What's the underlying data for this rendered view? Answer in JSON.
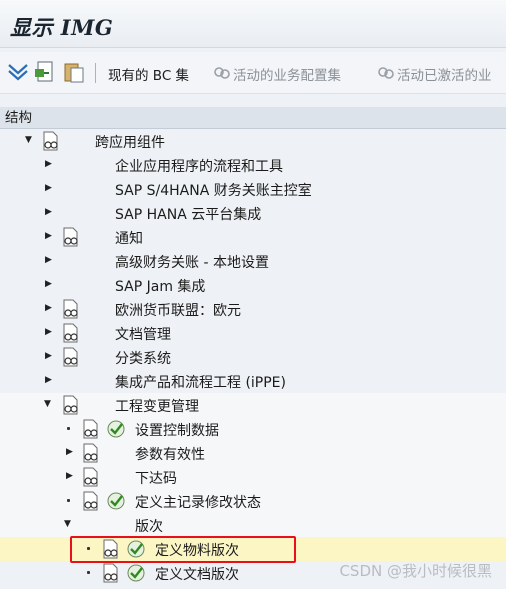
{
  "window": {
    "title": "显示 IMG"
  },
  "toolbar": {
    "bc_sets_label": "现有的 BC 集",
    "active_bc_label": "活动的业务配置集",
    "activated_label": "活动已激活的业"
  },
  "structure_header": "结构",
  "tree": {
    "root": "跨应用组件",
    "items": [
      "企业应用程序的流程和工具",
      "SAP S/4HANA 财务关账主控室",
      "SAP HANA 云平台集成",
      "通知",
      "高级财务关账 - 本地设置",
      "SAP Jam 集成",
      "欧洲货币联盟：欧元",
      "文档管理",
      "分类系统",
      "集成产品和流程工程 (iPPE)",
      "工程变更管理"
    ],
    "ecm_children": [
      "设置控制数据",
      "参数有效性",
      "下达码",
      "定义主记录修改状态",
      "版次"
    ],
    "version_children": [
      "定义物料版次",
      "定义文档版次"
    ]
  },
  "watermark": "CSDN @我小时候很黑",
  "colors": {
    "highlight": "#fbf6c4",
    "red_box": "#e8101a"
  }
}
